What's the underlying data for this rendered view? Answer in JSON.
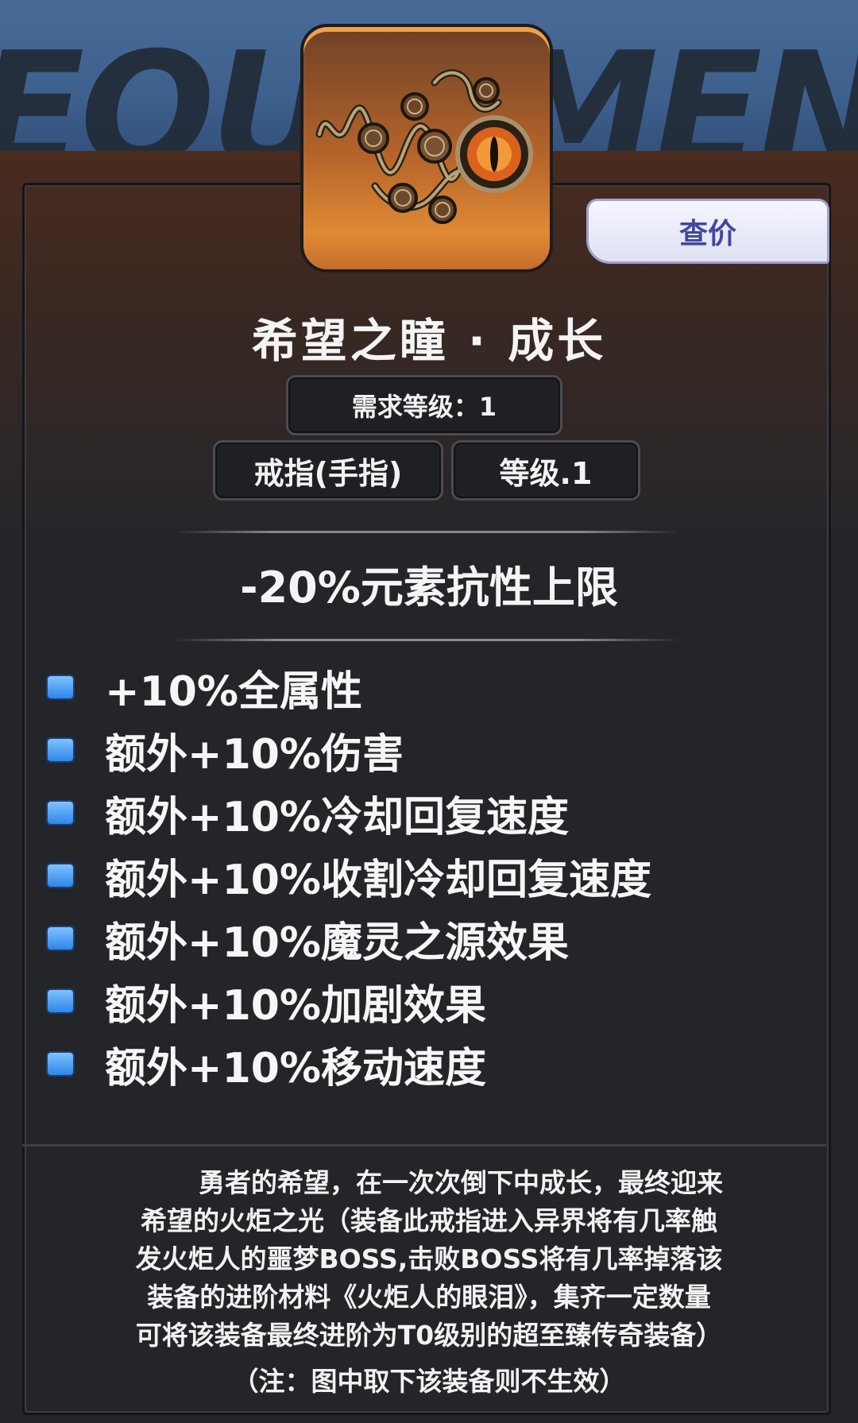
{
  "background": {
    "title_text": "EQUIPMENT",
    "accent_color": "#3f5f86"
  },
  "item": {
    "name": "希望之瞳 · 成长",
    "icon": "steampunk-ring-eye-icon",
    "price_button": "查价",
    "required_level": "需求等级：1",
    "slot": "戒指(手指)",
    "level": "等级.1"
  },
  "main_stat": "-20%元素抗性上限",
  "stats": [
    "+10%全属性",
    "额外+10%伤害",
    "额外+10%冷却回复速度",
    "额外+10%收割冷却回复速度",
    "额外+10%魔灵之源效果",
    "额外+10%加剧效果",
    "额外+10%移动速度"
  ],
  "description": [
    "勇者的希望，在一次次倒下中成长，最终迎来",
    "希望的火炬之光（装备此戒指进入异界将有几率触",
    "发火炬人的噩梦BOSS,击败BOSS将有几率掉落该",
    "装备的进阶材料《火炬人的眼泪》，集齐一定数量",
    "可将该装备最终进阶为T0级别的超至臻传奇装备）",
    "（注：图中取下该装备则不生效）"
  ],
  "colors": {
    "bullet": "#3a8ff0",
    "price_text": "#4148a0",
    "icon_bg": "#c46e2c"
  }
}
